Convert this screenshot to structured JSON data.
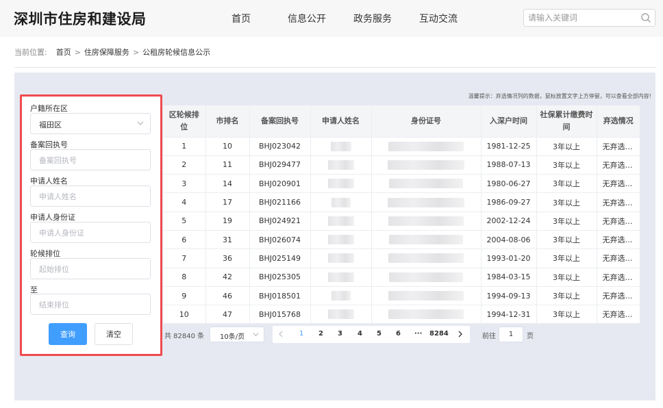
{
  "header": {
    "site_title": "深圳市住房和建设局",
    "nav": [
      "首页",
      "信息公开",
      "政务服务",
      "互动交流"
    ],
    "search_placeholder": "请输入关键词"
  },
  "breadcrumb": {
    "label": "当前位置:",
    "items": [
      "首页",
      "住房保障服务",
      "公租房轮候信息公示"
    ]
  },
  "tip": "温馨提示：弃选情况列的数据，鼠标放置文字上方停留，可以查看全部内容!",
  "filter": {
    "district_label": "户籍所在区",
    "district_value": "福田区",
    "receipt_label": "备案回执号",
    "receipt_placeholder": "备案回执号",
    "name_label": "申请人姓名",
    "name_placeholder": "申请人姓名",
    "id_label": "申请人身份证",
    "id_placeholder": "申请人身份证",
    "rank_label": "轮候排位",
    "rank_from_placeholder": "起始排位",
    "to_label": "至",
    "rank_to_placeholder": "结束排位",
    "query_button": "查询",
    "clear_button": "清空"
  },
  "table": {
    "headers": [
      "区轮候排位",
      "市排名",
      "备案回执号",
      "申请人姓名",
      "身份证号",
      "入深户时间",
      "社保累计缴费时间",
      "弃选情况"
    ],
    "rows": [
      {
        "district_rank": "1",
        "city_rank": "10",
        "receipt": "BHJ023042",
        "join_date": "1981-12-25",
        "social": "3年以上",
        "abandon": "无弃选记录"
      },
      {
        "district_rank": "2",
        "city_rank": "11",
        "receipt": "BHJ029477",
        "join_date": "1988-07-13",
        "social": "3年以上",
        "abandon": "无弃选记录"
      },
      {
        "district_rank": "3",
        "city_rank": "14",
        "receipt": "BHJ020901",
        "join_date": "1980-06-27",
        "social": "3年以上",
        "abandon": "无弃选记录"
      },
      {
        "district_rank": "4",
        "city_rank": "17",
        "receipt": "BHJ021166",
        "join_date": "1986-09-27",
        "social": "3年以上",
        "abandon": "无弃选记录"
      },
      {
        "district_rank": "5",
        "city_rank": "19",
        "receipt": "BHJ024921",
        "join_date": "2002-12-24",
        "social": "3年以上",
        "abandon": "无弃选记录"
      },
      {
        "district_rank": "6",
        "city_rank": "31",
        "receipt": "BHJ026074",
        "join_date": "2004-08-06",
        "social": "3年以上",
        "abandon": "无弃选记录"
      },
      {
        "district_rank": "7",
        "city_rank": "36",
        "receipt": "BHJ025149",
        "join_date": "1993-01-20",
        "social": "3年以上",
        "abandon": "无弃选记录"
      },
      {
        "district_rank": "8",
        "city_rank": "42",
        "receipt": "BHJ025305",
        "join_date": "1984-03-15",
        "social": "3年以上",
        "abandon": "无弃选记录"
      },
      {
        "district_rank": "9",
        "city_rank": "46",
        "receipt": "BHJ018501",
        "join_date": "1994-09-13",
        "social": "3年以上",
        "abandon": "无弃选记录"
      },
      {
        "district_rank": "10",
        "city_rank": "47",
        "receipt": "BHJ015768",
        "join_date": "1994-12-31",
        "social": "3年以上",
        "abandon": "无弃选记录"
      }
    ]
  },
  "pagination": {
    "total": "共 82840 条",
    "page_size": "10条/页",
    "pages": [
      "1",
      "2",
      "3",
      "4",
      "5",
      "6",
      "···",
      "8284"
    ],
    "active_page": "1",
    "goto_label": "前往",
    "goto_value": "1",
    "goto_unit": "页"
  },
  "colors": {
    "primary": "#409eff",
    "highlight_border": "#ef4a4e",
    "panel_bg": "#e6e9f1"
  }
}
